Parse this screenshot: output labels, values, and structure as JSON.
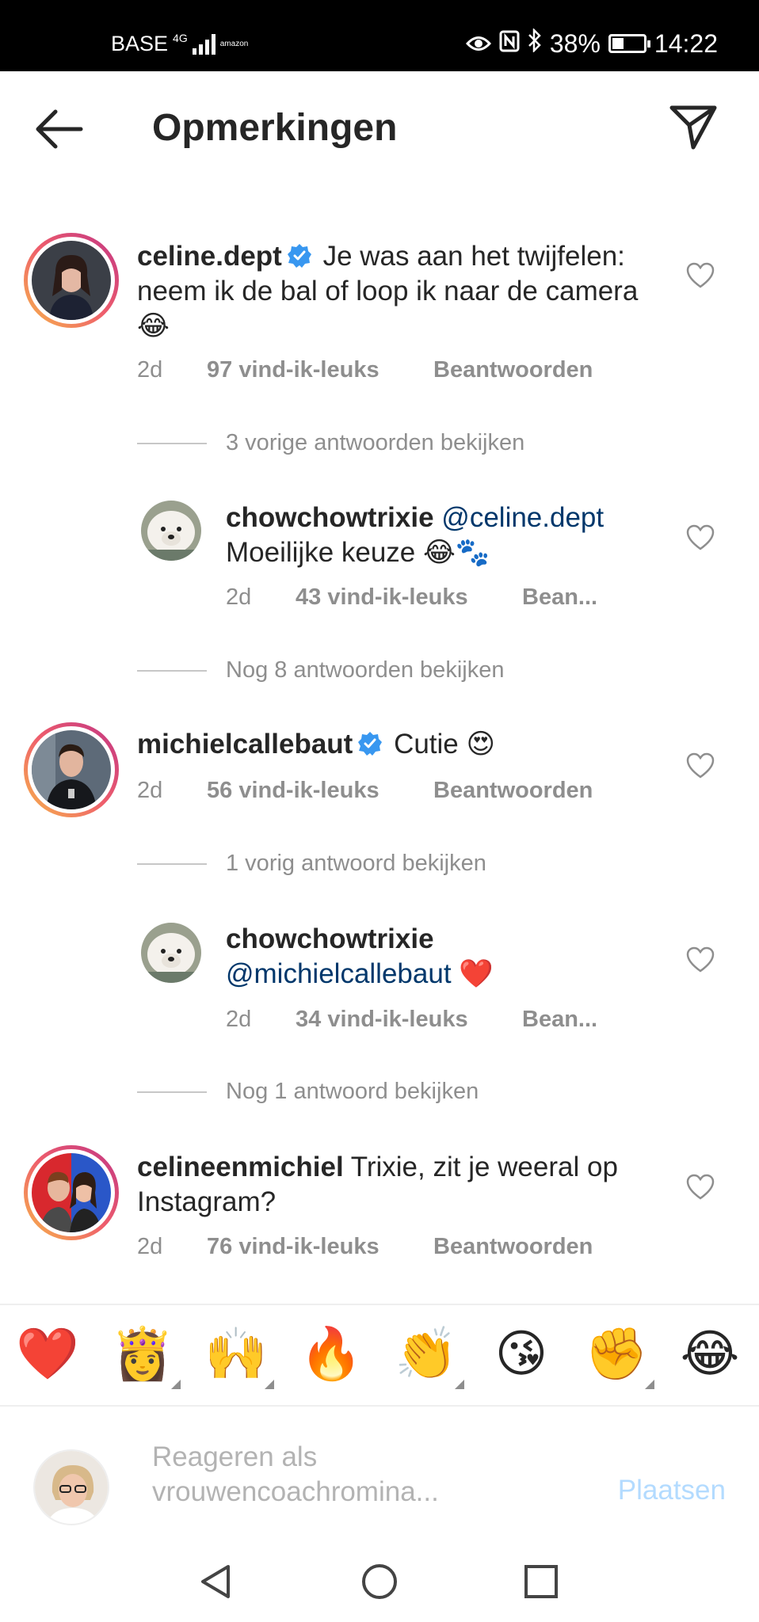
{
  "status_bar": {
    "carrier": "BASE",
    "network": "4G",
    "app_badge": "amazon",
    "battery": "38%",
    "battery_level": 0.38,
    "time": "14:22"
  },
  "header": {
    "title": "Opmerkingen"
  },
  "comments": [
    {
      "username": "celine.dept",
      "verified": true,
      "text": "Je was aan het twijfelen: neem ik de bal of loop ik naar de camera 😂",
      "age": "2d",
      "likes": "97 vind-ik-leuks",
      "reply": "Beantwoorden",
      "view_replies": "3 vorige antwoorden bekijken"
    },
    {
      "username": "chowchowtrixie",
      "mention": "@celine.dept",
      "text": "Moeilijke keuze 😂🐾",
      "age": "2d",
      "likes": "43 vind-ik-leuks",
      "reply": "Bean...",
      "view_replies": "Nog 8 antwoorden bekijken"
    },
    {
      "username": "michielcallebaut",
      "verified": true,
      "text": "Cutie 😍",
      "age": "2d",
      "likes": "56 vind-ik-leuks",
      "reply": "Beantwoorden",
      "view_replies": "1 vorig antwoord bekijken"
    },
    {
      "username": "chowchowtrixie",
      "mention": "@michielcallebaut",
      "text": "❤️",
      "age": "2d",
      "likes": "34 vind-ik-leuks",
      "reply": "Bean...",
      "view_replies": "Nog 1 antwoord bekijken"
    },
    {
      "username": "celineenmichiel",
      "text": "Trixie, zit je weeral op Instagram?",
      "age": "2d",
      "likes": "76 vind-ik-leuks",
      "reply": "Beantwoorden"
    }
  ],
  "emoji_bar": [
    "❤️",
    "👸",
    "🙌",
    "🔥",
    "👏",
    "😘",
    "✊",
    "😂"
  ],
  "composer": {
    "placeholder": "Reageren als vrouwencoachromina...",
    "post_label": "Plaatsen"
  },
  "colors": {
    "text": "#262626",
    "muted": "#8e8e8e",
    "mention": "#00376b",
    "verified": "#3897f0",
    "post_disabled": "#b3dbff"
  },
  "icons": [
    "back-arrow-icon",
    "send-icon",
    "verified-badge-icon",
    "heart-outline-icon",
    "nav-back-icon",
    "nav-home-icon",
    "nav-recents-icon"
  ]
}
